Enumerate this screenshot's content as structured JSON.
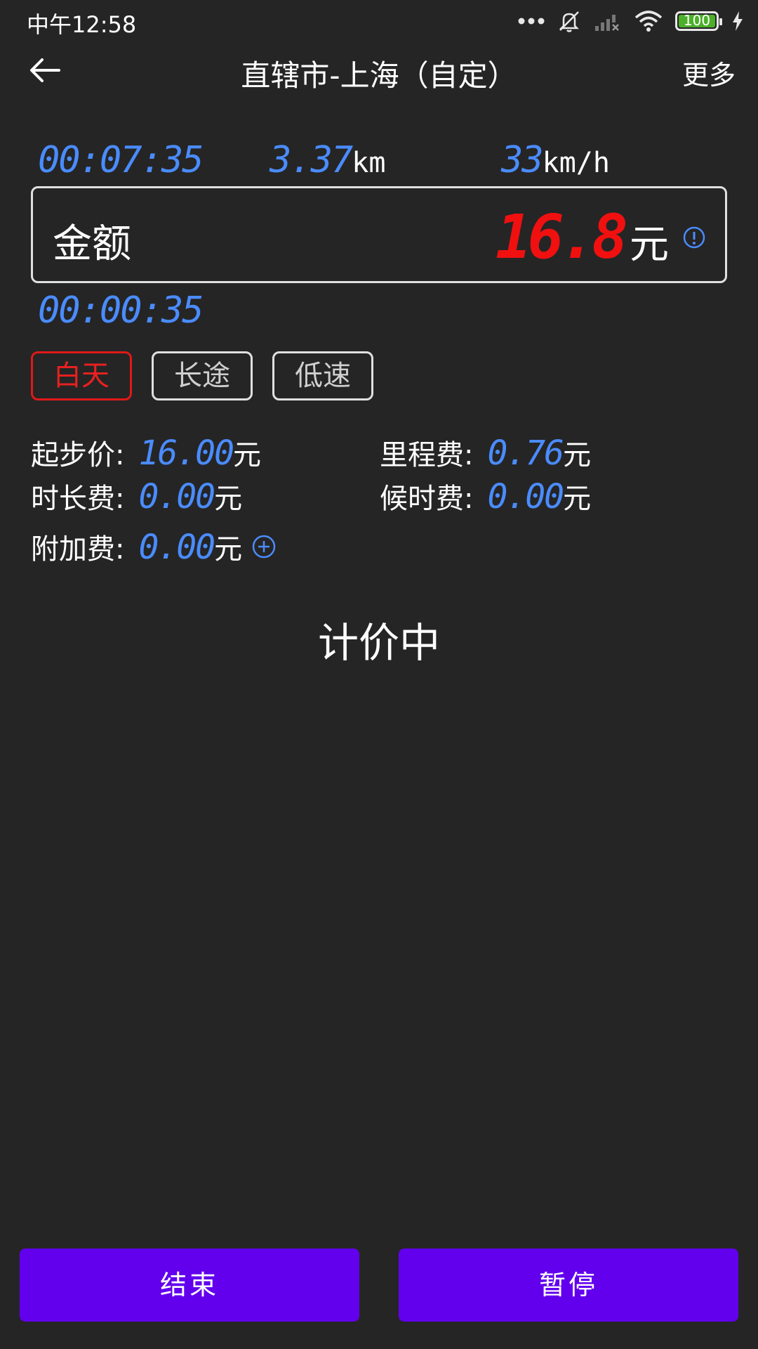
{
  "status_bar": {
    "time": "中午12:58",
    "battery": "100",
    "icons": [
      "more-dots-icon",
      "bell-off-icon",
      "signal-icon",
      "wifi-icon",
      "battery-icon",
      "charging-icon"
    ]
  },
  "header": {
    "title": "直辖市-上海（自定）",
    "more": "更多",
    "back_icon": "arrow-left-icon"
  },
  "meter": {
    "elapsed_time": "00:07:35",
    "distance": "3.37",
    "distance_unit": "km",
    "speed": "33",
    "speed_unit": "km/h",
    "wait_time": "00:00:35"
  },
  "amount": {
    "label": "金额",
    "value": "16.8",
    "unit": "元"
  },
  "modes": [
    {
      "label": "白天",
      "active": true
    },
    {
      "label": "长途",
      "active": false
    },
    {
      "label": "低速",
      "active": false
    }
  ],
  "fees": {
    "base_label": "起步价:",
    "base_value": "16.00",
    "mileage_label": "里程费:",
    "mileage_value": "0.76",
    "duration_label": "时长费:",
    "duration_value": "0.00",
    "waiting_label": "候时费:",
    "waiting_value": "0.00",
    "extra_label": "附加费:",
    "extra_value": "0.00",
    "unit": "元"
  },
  "status_text": "计价中",
  "buttons": {
    "end": "结束",
    "pause": "暂停"
  },
  "colors": {
    "background": "#252525",
    "digits": "#4a8cff",
    "amount": "#f01010",
    "active_mode": "#e01818",
    "button": "#6200ee"
  }
}
